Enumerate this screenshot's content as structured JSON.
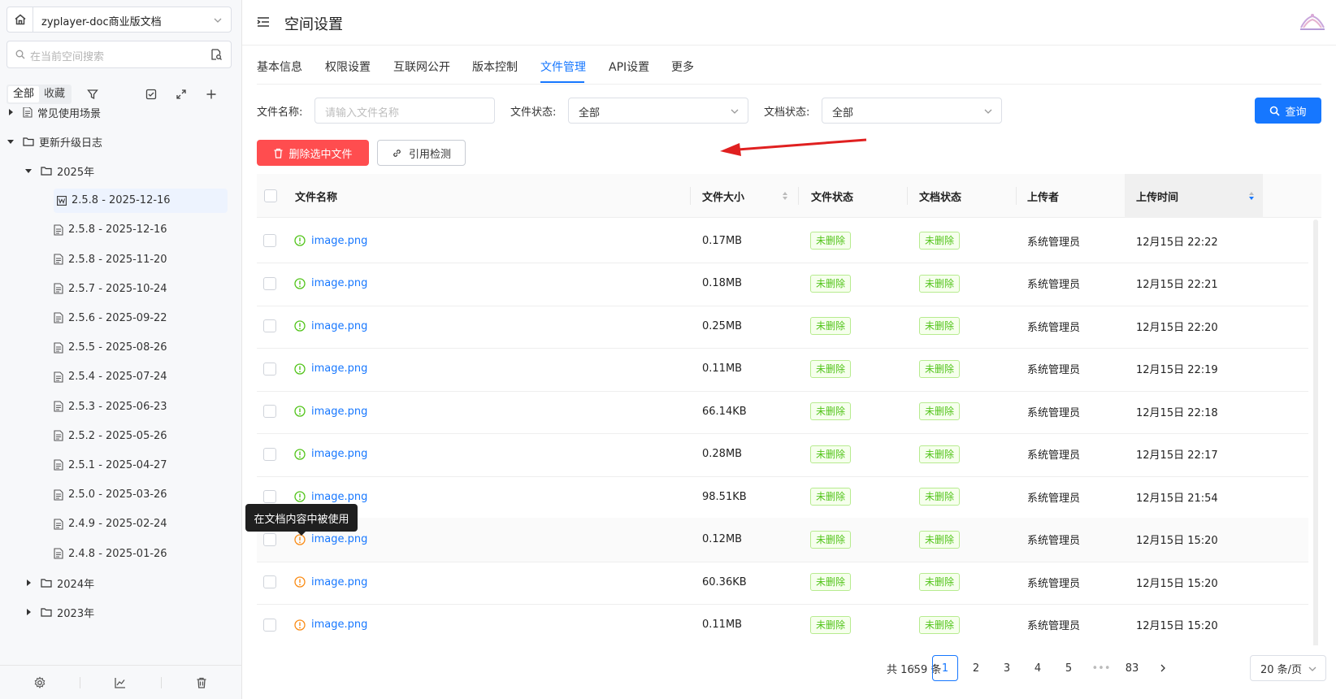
{
  "sidebar": {
    "space_name": "zyplayer-doc商业版文档",
    "search_placeholder": "在当前空间搜索",
    "filter_all": "全部",
    "filter_fav": "收藏",
    "tree": [
      {
        "label": "常见使用场景",
        "kind": "doc",
        "caret": "right",
        "indent": 0
      },
      {
        "label": "更新升级日志",
        "kind": "folder",
        "caret": "down",
        "indent": 0
      },
      {
        "label": "2025年",
        "kind": "folder",
        "caret": "down",
        "indent": 1
      },
      {
        "label": "2.5.8 - 2025-12-16",
        "kind": "word",
        "caret": "",
        "indent": 2,
        "selected": true
      },
      {
        "label": "2.5.8 - 2025-12-16",
        "kind": "doc",
        "caret": "",
        "indent": 2
      },
      {
        "label": "2.5.8 - 2025-11-20",
        "kind": "doc",
        "caret": "",
        "indent": 2
      },
      {
        "label": "2.5.7 - 2025-10-24",
        "kind": "doc",
        "caret": "",
        "indent": 2
      },
      {
        "label": "2.5.6 - 2025-09-22",
        "kind": "doc",
        "caret": "",
        "indent": 2
      },
      {
        "label": "2.5.5 - 2025-08-26",
        "kind": "doc",
        "caret": "",
        "indent": 2
      },
      {
        "label": "2.5.4 - 2025-07-24",
        "kind": "doc",
        "caret": "",
        "indent": 2
      },
      {
        "label": "2.5.3 - 2025-06-23",
        "kind": "doc",
        "caret": "",
        "indent": 2
      },
      {
        "label": "2.5.2 - 2025-05-26",
        "kind": "doc",
        "caret": "",
        "indent": 2
      },
      {
        "label": "2.5.1 - 2025-04-27",
        "kind": "doc",
        "caret": "",
        "indent": 2
      },
      {
        "label": "2.5.0 - 2025-03-26",
        "kind": "doc",
        "caret": "",
        "indent": 2
      },
      {
        "label": "2.4.9 - 2025-02-24",
        "kind": "doc",
        "caret": "",
        "indent": 2
      },
      {
        "label": "2.4.8 - 2025-01-26",
        "kind": "doc",
        "caret": "",
        "indent": 2
      },
      {
        "label": "2024年",
        "kind": "folder",
        "caret": "right",
        "indent": 1
      },
      {
        "label": "2023年",
        "kind": "folder",
        "caret": "right",
        "indent": 1
      }
    ]
  },
  "header": {
    "title": "空间设置"
  },
  "tabs": [
    {
      "label": "基本信息"
    },
    {
      "label": "权限设置"
    },
    {
      "label": "互联网公开"
    },
    {
      "label": "版本控制"
    },
    {
      "label": "文件管理",
      "active": true
    },
    {
      "label": "API设置"
    },
    {
      "label": "更多"
    }
  ],
  "filters": {
    "name_label": "文件名称:",
    "name_placeholder": "请输入文件名称",
    "file_status_label": "文件状态:",
    "file_status_value": "全部",
    "doc_status_label": "文档状态:",
    "doc_status_value": "全部",
    "query_label": "查询"
  },
  "actions": {
    "delete_label": "删除选中文件",
    "check_label": "引用检测"
  },
  "table": {
    "columns": [
      "文件名称",
      "文件大小",
      "文件状态",
      "文档状态",
      "上传者",
      "上传时间"
    ],
    "rows": [
      {
        "name": "image.png",
        "size": "0.17MB",
        "file_status": "未删除",
        "doc_status": "未删除",
        "uploader": "系统管理员",
        "time": "12月15日 22:22",
        "ref": "green"
      },
      {
        "name": "image.png",
        "size": "0.18MB",
        "file_status": "未删除",
        "doc_status": "未删除",
        "uploader": "系统管理员",
        "time": "12月15日 22:21",
        "ref": "green"
      },
      {
        "name": "image.png",
        "size": "0.25MB",
        "file_status": "未删除",
        "doc_status": "未删除",
        "uploader": "系统管理员",
        "time": "12月15日 22:20",
        "ref": "green"
      },
      {
        "name": "image.png",
        "size": "0.11MB",
        "file_status": "未删除",
        "doc_status": "未删除",
        "uploader": "系统管理员",
        "time": "12月15日 22:19",
        "ref": "green"
      },
      {
        "name": "image.png",
        "size": "66.14KB",
        "file_status": "未删除",
        "doc_status": "未删除",
        "uploader": "系统管理员",
        "time": "12月15日 22:18",
        "ref": "green"
      },
      {
        "name": "image.png",
        "size": "0.28MB",
        "file_status": "未删除",
        "doc_status": "未删除",
        "uploader": "系统管理员",
        "time": "12月15日 22:17",
        "ref": "green"
      },
      {
        "name": "image.png",
        "size": "98.51KB",
        "file_status": "未删除",
        "doc_status": "未删除",
        "uploader": "系统管理员",
        "time": "12月15日 21:54",
        "ref": "green"
      },
      {
        "name": "image.png",
        "size": "0.12MB",
        "file_status": "未删除",
        "doc_status": "未删除",
        "uploader": "系统管理员",
        "time": "12月15日 15:20",
        "ref": "orange",
        "hover": true
      },
      {
        "name": "image.png",
        "size": "60.36KB",
        "file_status": "未删除",
        "doc_status": "未删除",
        "uploader": "系统管理员",
        "time": "12月15日 15:20",
        "ref": "orange"
      },
      {
        "name": "image.png",
        "size": "0.11MB",
        "file_status": "未删除",
        "doc_status": "未删除",
        "uploader": "系统管理员",
        "time": "12月15日 15:20",
        "ref": "orange"
      }
    ],
    "tooltip": "在文档内容中被使用"
  },
  "pagination": {
    "total": "共 1659 条",
    "pages": [
      "1",
      "2",
      "3",
      "4",
      "5",
      "•••",
      "83"
    ],
    "current": "1",
    "page_size": "20 条/页"
  },
  "colors": {
    "accent": "#1677ff",
    "danger": "#ff4d4f",
    "tag_green": "#52c41a",
    "ref_ok": "#52c41a",
    "ref_used": "#fa8c16",
    "arrow": "#e02020"
  }
}
